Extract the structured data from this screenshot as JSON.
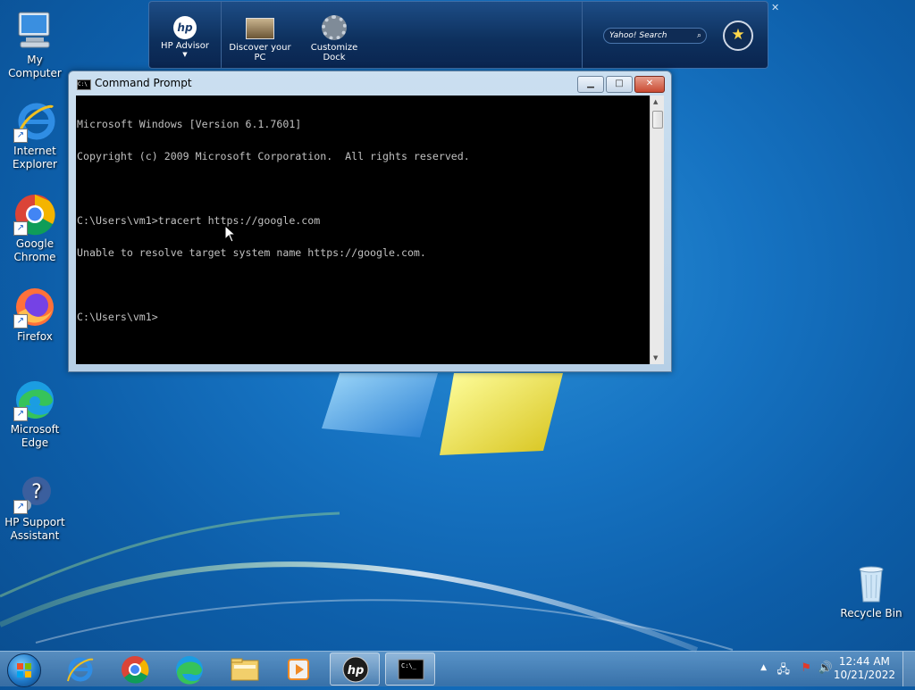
{
  "desktop": {
    "icons": [
      {
        "label": "My Computer",
        "icon": "computer-icon"
      },
      {
        "label": "Internet Explorer",
        "icon": "internet-explorer-icon"
      },
      {
        "label": "Google Chrome",
        "icon": "chrome-icon"
      },
      {
        "label": "Firefox",
        "icon": "firefox-icon"
      },
      {
        "label": "Microsoft Edge",
        "icon": "edge-icon"
      },
      {
        "label": "HP Support Assistant",
        "icon": "hp-support-icon"
      },
      {
        "label": "Recycle Bin",
        "icon": "recycle-bin-icon"
      }
    ]
  },
  "dock": {
    "items": [
      {
        "label": "HP Advisor",
        "icon": "hp-logo-icon"
      },
      {
        "label": "Discover your PC",
        "icon": "discover-pc-icon"
      },
      {
        "label": "Customize Dock",
        "icon": "gear-icon"
      }
    ],
    "search_placeholder": "Yahoo! Search",
    "favorite_icon": "star-icon"
  },
  "cmd": {
    "title": "Command Prompt",
    "lines": [
      "Microsoft Windows [Version 6.1.7601]",
      "Copyright (c) 2009 Microsoft Corporation.  All rights reserved.",
      "",
      "C:\\Users\\vm1>tracert https://google.com",
      "Unable to resolve target system name https://google.com.",
      "",
      "C:\\Users\\vm1>"
    ],
    "minimize_label": "▁",
    "maximize_label": "□",
    "close_label": "✕"
  },
  "taskbar": {
    "pinned": [
      {
        "name": "internet-explorer",
        "icon": "internet-explorer-icon"
      },
      {
        "name": "chrome",
        "icon": "chrome-icon"
      },
      {
        "name": "edge",
        "icon": "edge-icon"
      },
      {
        "name": "file-explorer",
        "icon": "folder-icon"
      },
      {
        "name": "media-player",
        "icon": "media-player-icon"
      },
      {
        "name": "hp",
        "icon": "hp-logo-icon"
      },
      {
        "name": "command-prompt",
        "icon": "cmd-icon"
      }
    ],
    "time": "12:44 AM",
    "date": "10/21/2022"
  }
}
